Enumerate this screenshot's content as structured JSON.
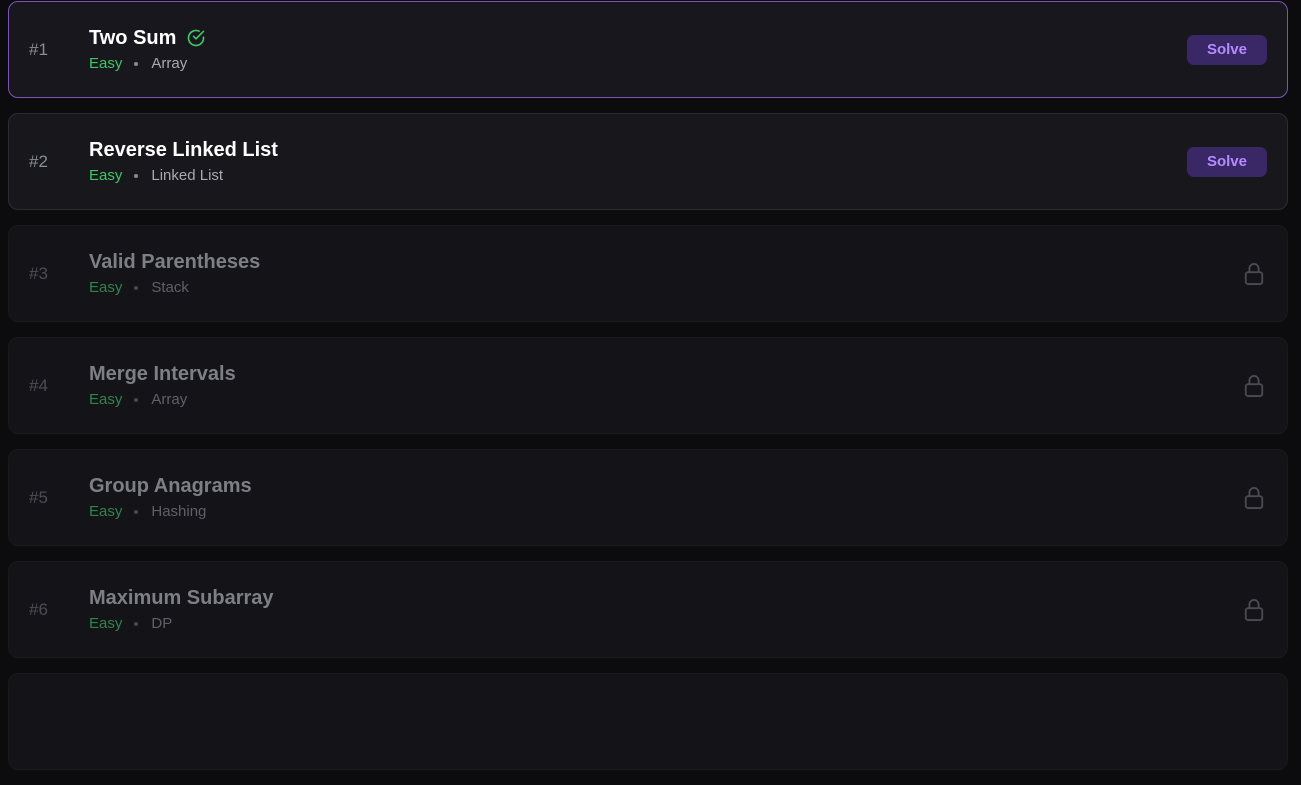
{
  "problems": [
    {
      "number": "#1",
      "title": "Two Sum",
      "difficulty": "Easy",
      "tag": "Array",
      "status": "solved",
      "action_label": "Solve"
    },
    {
      "number": "#2",
      "title": "Reverse Linked List",
      "difficulty": "Easy",
      "tag": "Linked List",
      "status": "unlocked",
      "action_label": "Solve"
    },
    {
      "number": "#3",
      "title": "Valid Parentheses",
      "difficulty": "Easy",
      "tag": "Stack",
      "status": "locked"
    },
    {
      "number": "#4",
      "title": "Merge Intervals",
      "difficulty": "Easy",
      "tag": "Array",
      "status": "locked"
    },
    {
      "number": "#5",
      "title": "Group Anagrams",
      "difficulty": "Easy",
      "tag": "Hashing",
      "status": "locked"
    },
    {
      "number": "#6",
      "title": "Maximum Subarray",
      "difficulty": "Easy",
      "tag": "DP",
      "status": "locked"
    }
  ],
  "icons": {
    "solved": "check-circle-icon",
    "locked": "lock-icon"
  },
  "colors": {
    "accent": "#b48cff",
    "accent_bg": "#3a2766",
    "easy": "#3fc764",
    "selected_border": "#7b54b8"
  }
}
